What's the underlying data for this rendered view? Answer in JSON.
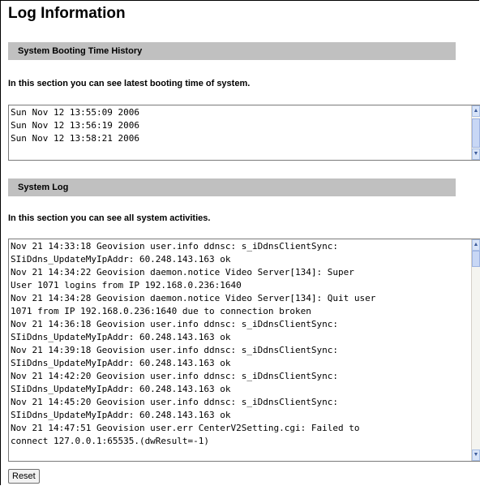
{
  "page": {
    "title": "Log Information"
  },
  "booting": {
    "header": "System Booting Time History",
    "description": "In this section you can see latest booting time of system.",
    "lines": "Sun Nov 12 13:55:09 2006\nSun Nov 12 13:56:19 2006\nSun Nov 12 13:58:21 2006"
  },
  "system_log": {
    "header": "System Log",
    "description": "In this section you can see all system activities.",
    "text": "Nov 21 14:33:18 Geovision user.info ddnsc: s_iDdnsClientSync:\nSIiDdns_UpdateMyIpAddr: 60.248.143.163 ok\nNov 21 14:34:22 Geovision daemon.notice Video Server[134]: Super\nUser 1071 logins from IP 192.168.0.236:1640\nNov 21 14:34:28 Geovision daemon.notice Video Server[134]: Quit user\n1071 from IP 192.168.0.236:1640 due to connection broken\nNov 21 14:36:18 Geovision user.info ddnsc: s_iDdnsClientSync:\nSIiDdns_UpdateMyIpAddr: 60.248.143.163 ok\nNov 21 14:39:18 Geovision user.info ddnsc: s_iDdnsClientSync:\nSIiDdns_UpdateMyIpAddr: 60.248.143.163 ok\nNov 21 14:42:20 Geovision user.info ddnsc: s_iDdnsClientSync:\nSIiDdns_UpdateMyIpAddr: 60.248.143.163 ok\nNov 21 14:45:20 Geovision user.info ddnsc: s_iDdnsClientSync:\nSIiDdns_UpdateMyIpAddr: 60.248.143.163 ok\nNov 21 14:47:51 Geovision user.err CenterV2Setting.cgi: Failed to\nconnect 127.0.0.1:65535.(dwResult=-1)"
  },
  "actions": {
    "reset_label": "Reset"
  },
  "icons": {
    "scroll_up": "chevron-up-icon",
    "scroll_down": "chevron-down-icon"
  }
}
